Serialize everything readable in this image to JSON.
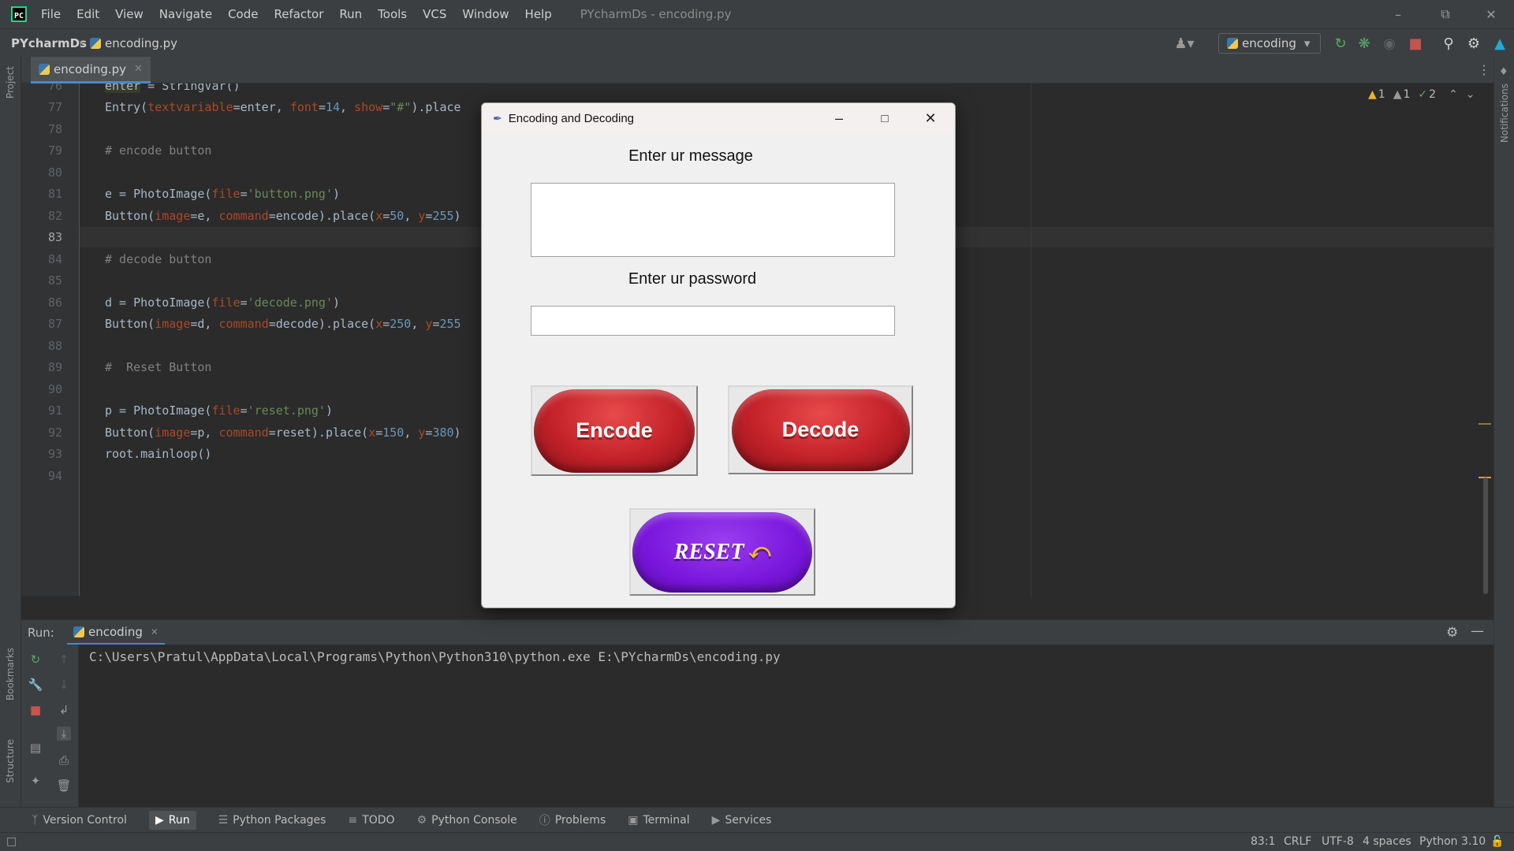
{
  "window": {
    "title": "PYcharmDs - encoding.py",
    "menu": [
      "File",
      "Edit",
      "View",
      "Navigate",
      "Code",
      "Refactor",
      "Run",
      "Tools",
      "VCS",
      "Window",
      "Help"
    ]
  },
  "navbar": {
    "project": "PYcharmDs",
    "file": "encoding.py",
    "run_config": "encoding"
  },
  "sidebar": {
    "project_label": "Project",
    "bookmarks_label": "Bookmarks",
    "structure_label": "Structure",
    "notifications_label": "Notifications"
  },
  "editor": {
    "tab": "encoding.py",
    "inspections": {
      "warnings": "1",
      "weak_warnings": "1",
      "ok": "2"
    },
    "lines": [
      {
        "n": "76",
        "text": "enter = StringVar()"
      },
      {
        "n": "77",
        "text": "Entry(textvariable=enter, font=14, show=\"#\").place"
      },
      {
        "n": "78",
        "text": ""
      },
      {
        "n": "79",
        "text": "# encode button"
      },
      {
        "n": "80",
        "text": ""
      },
      {
        "n": "81",
        "text": "e = PhotoImage(file='button.png')"
      },
      {
        "n": "82",
        "text": "Button(image=e, command=encode).place(x=50, y=255)"
      },
      {
        "n": "83",
        "text": ""
      },
      {
        "n": "84",
        "text": "# decode button"
      },
      {
        "n": "85",
        "text": ""
      },
      {
        "n": "86",
        "text": "d = PhotoImage(file='decode.png')"
      },
      {
        "n": "87",
        "text": "Button(image=d, command=decode).place(x=250, y=255"
      },
      {
        "n": "88",
        "text": ""
      },
      {
        "n": "89",
        "text": "#  Reset Button"
      },
      {
        "n": "90",
        "text": ""
      },
      {
        "n": "91",
        "text": "p = PhotoImage(file='reset.png')"
      },
      {
        "n": "92",
        "text": "Button(image=p, command=reset).place(x=150, y=380)"
      },
      {
        "n": "93",
        "text": "root.mainloop()"
      },
      {
        "n": "94",
        "text": ""
      }
    ]
  },
  "run_panel": {
    "label": "Run:",
    "tab": "encoding",
    "command": "C:\\Users\\Pratul\\AppData\\Local\\Programs\\Python\\Python310\\python.exe E:\\PYcharmDs\\encoding.py"
  },
  "tool_windows": [
    "Version Control",
    "Run",
    "Python Packages",
    "TODO",
    "Python Console",
    "Problems",
    "Terminal",
    "Services"
  ],
  "status_bar": {
    "position": "83:1",
    "line_sep": "CRLF",
    "encoding": "UTF-8",
    "indent": "4 spaces",
    "interpreter": "Python 3.10"
  },
  "dialog": {
    "title": "Encoding and Decoding",
    "message_label": "Enter ur message",
    "message_value": "",
    "password_label": "Enter ur password",
    "password_value": "",
    "encode_label": "Encode",
    "decode_label": "Decode",
    "reset_label": "RESET",
    "encode_color": "#c3222a",
    "reset_color": "#7a16dc"
  }
}
